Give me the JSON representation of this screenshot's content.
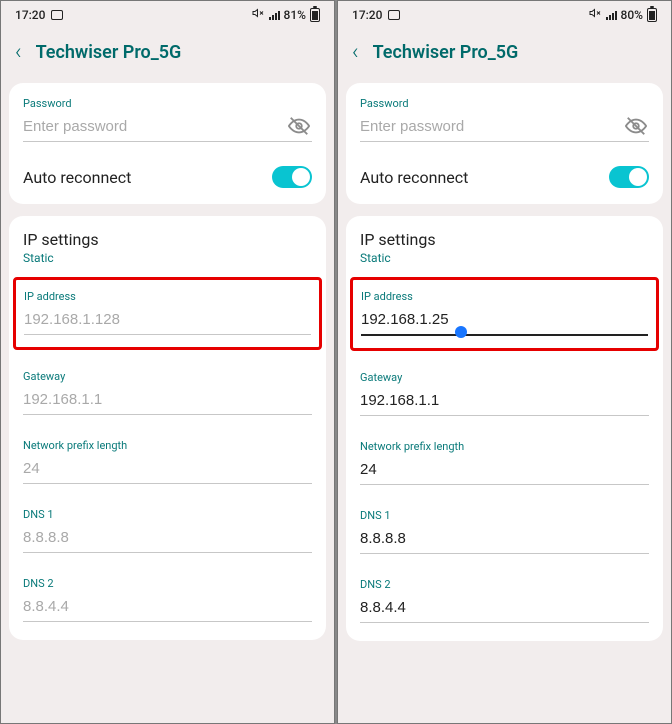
{
  "screens": [
    {
      "status": {
        "time": "17:20",
        "battery": "81%"
      },
      "title": "Techwiser Pro_5G",
      "password": {
        "label": "Password",
        "placeholder": "Enter password"
      },
      "autoReconnect": {
        "label": "Auto reconnect",
        "on": true
      },
      "ipSettings": {
        "heading": "IP settings",
        "mode": "Static"
      },
      "ipAddress": {
        "label": "IP address",
        "value": "192.168.1.128",
        "filled": false,
        "focused": false
      },
      "gateway": {
        "label": "Gateway",
        "value": "192.168.1.1",
        "filled": false
      },
      "prefix": {
        "label": "Network prefix length",
        "value": "24",
        "filled": false
      },
      "dns1": {
        "label": "DNS 1",
        "value": "8.8.8.8",
        "filled": false
      },
      "dns2": {
        "label": "DNS 2",
        "value": "8.8.4.4",
        "filled": false
      }
    },
    {
      "status": {
        "time": "17:20",
        "battery": "80%"
      },
      "title": "Techwiser Pro_5G",
      "password": {
        "label": "Password",
        "placeholder": "Enter password"
      },
      "autoReconnect": {
        "label": "Auto reconnect",
        "on": true
      },
      "ipSettings": {
        "heading": "IP settings",
        "mode": "Static"
      },
      "ipAddress": {
        "label": "IP address",
        "value": "192.168.1.25",
        "filled": true,
        "focused": true
      },
      "gateway": {
        "label": "Gateway",
        "value": "192.168.1.1",
        "filled": true
      },
      "prefix": {
        "label": "Network prefix length",
        "value": "24",
        "filled": true
      },
      "dns1": {
        "label": "DNS 1",
        "value": "8.8.8.8",
        "filled": true
      },
      "dns2": {
        "label": "DNS 2",
        "value": "8.8.4.4",
        "filled": true
      }
    }
  ]
}
